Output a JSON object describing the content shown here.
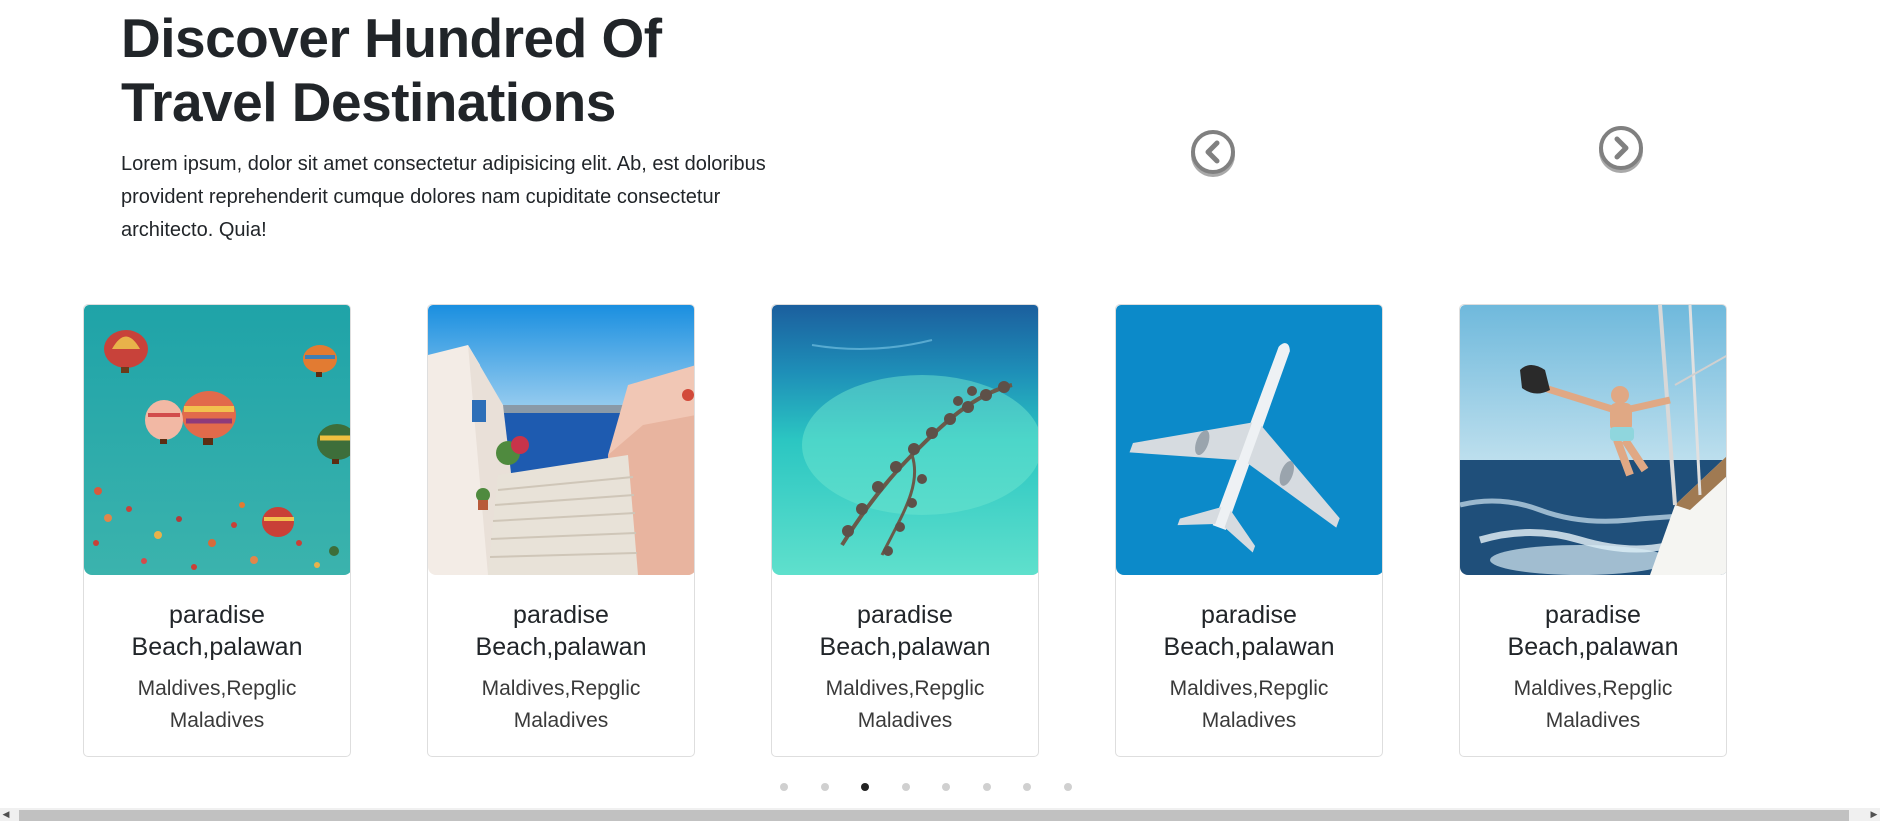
{
  "hero": {
    "title_line1": "Discover Hundred Of",
    "title_line2": "Travel Destinations",
    "description": "Lorem ipsum, dolor sit amet consectetur adipisicing elit. Ab, est doloribus provident reprehenderit cumque dolores nam cupiditate consectetur architecto. Quia!"
  },
  "carousel": {
    "prev_icon": "chevron-left-circle-icon",
    "next_icon": "chevron-right-circle-icon",
    "cards": [
      {
        "image": "hot-air-balloons-image",
        "title_line1": "paradise",
        "title_line2": "Beach,palawan",
        "subtitle_line1": "Maldives,Repglic",
        "subtitle_line2": "Maladives"
      },
      {
        "image": "santorini-stairs-image",
        "title_line1": "paradise",
        "title_line2": "Beach,palawan",
        "subtitle_line1": "Maldives,Repglic",
        "subtitle_line2": "Maladives"
      },
      {
        "image": "maldives-villas-image",
        "title_line1": "paradise",
        "title_line2": "Beach,palawan",
        "subtitle_line1": "Maldives,Repglic",
        "subtitle_line2": "Maladives"
      },
      {
        "image": "airplane-image",
        "title_line1": "paradise",
        "title_line2": "Beach,palawan",
        "subtitle_line1": "Maldives,Repglic",
        "subtitle_line2": "Maladives"
      },
      {
        "image": "sailboat-man-image",
        "title_line1": "paradise",
        "title_line2": "Beach,palawan",
        "subtitle_line1": "Maldives,Repglic",
        "subtitle_line2": "Maladives"
      }
    ],
    "pagination": {
      "total": 8,
      "active_index": 2
    }
  },
  "colors": {
    "text": "#212529",
    "arrow_gray": "#808080",
    "dot_inactive": "#d0d0d0",
    "dot_active": "#222222"
  }
}
